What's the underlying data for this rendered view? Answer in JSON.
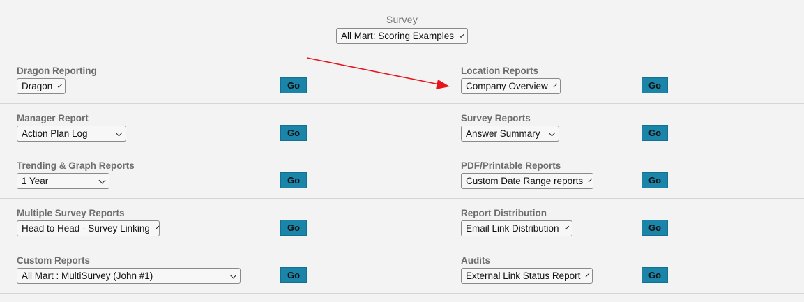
{
  "survey": {
    "label": "Survey",
    "selected": "All Mart: Scoring Examples"
  },
  "go_label": "Go",
  "rows": [
    {
      "left": {
        "label": "Dragon Reporting",
        "selected": "Dragon"
      },
      "right": {
        "label": "Location Reports",
        "selected": "Company Overview"
      }
    },
    {
      "left": {
        "label": "Manager Report",
        "selected": "Action Plan Log"
      },
      "right": {
        "label": "Survey Reports",
        "selected": "Answer Summary"
      }
    },
    {
      "left": {
        "label": "Trending & Graph Reports",
        "selected": "1 Year"
      },
      "right": {
        "label": "PDF/Printable Reports",
        "selected": "Custom Date Range reports"
      }
    },
    {
      "left": {
        "label": "Multiple Survey Reports",
        "selected": "Head to Head - Survey Linking"
      },
      "right": {
        "label": "Report Distribution",
        "selected": "Email Link Distribution"
      }
    },
    {
      "left": {
        "label": "Custom Reports",
        "selected": "All Mart : MultiSurvey (John #1)"
      },
      "right": {
        "label": "Audits",
        "selected": "External Link Status Report"
      }
    }
  ],
  "colors": {
    "background": "#f3f3f3",
    "go_button": "#1a85a8",
    "annotation_arrow": "#e8141b"
  }
}
